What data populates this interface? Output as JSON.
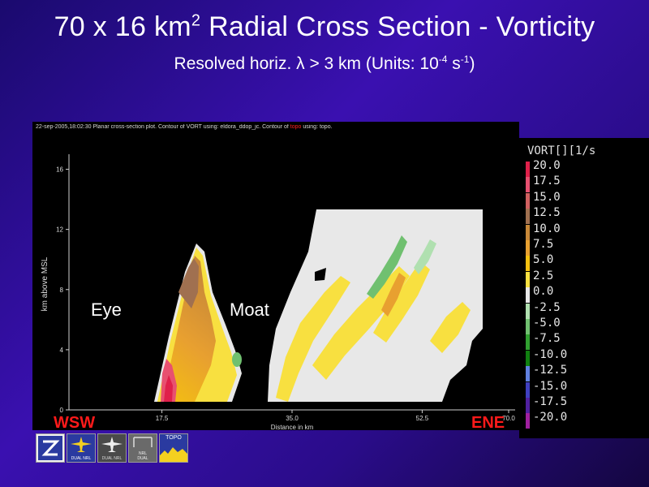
{
  "slide": {
    "title_main": "70 x 16 km",
    "title_sup": "2",
    "title_rest": " Radial Cross Section - Vorticity",
    "subtitle_pre": "Resolved horiz. λ > 3 km (Units: 10",
    "subtitle_sup1": "-4",
    "subtitle_mid": " s",
    "subtitle_sup2": "-1",
    "subtitle_post": ")"
  },
  "plot_header": {
    "text_a": "22-sep-2005,18:02:30  Planar cross-section plot.  Contour of VORT using: eldora_ddop_jc.  Contour of ",
    "text_topo": "topo",
    "text_b": " using: topo."
  },
  "chart_data": {
    "type": "heatmap",
    "xlabel": "Distance in km",
    "ylabel": "km above MSL",
    "xlim": [
      5,
      65
    ],
    "ylim": [
      0,
      17
    ],
    "x_ticks": [
      "17.5",
      "35.0",
      "52.5",
      "70.0"
    ],
    "y_ticks": [
      "0",
      "4",
      "8",
      "12",
      "16"
    ],
    "annotations": {
      "eye": "Eye",
      "moat": "Moat"
    },
    "legend": {
      "title": "VORT[][1/s",
      "levels": [
        {
          "label": "20.0",
          "color": "#e0204a"
        },
        {
          "label": "17.5",
          "color": "#e85070"
        },
        {
          "label": "15.0",
          "color": "#d06060"
        },
        {
          "label": "12.5",
          "color": "#a07050"
        },
        {
          "label": "10.0",
          "color": "#c88838"
        },
        {
          "label": "7.5",
          "color": "#e8a030"
        },
        {
          "label": "5.0",
          "color": "#f4c010"
        },
        {
          "label": "2.5",
          "color": "#f8e040"
        },
        {
          "label": "0.0",
          "color": "#e8e8e8"
        },
        {
          "label": "-2.5",
          "color": "#b0e0b0"
        },
        {
          "label": "-5.0",
          "color": "#70c070"
        },
        {
          "label": "-7.5",
          "color": "#30a030"
        },
        {
          "label": "-10.0",
          "color": "#108010"
        },
        {
          "label": "-12.5",
          "color": "#6080e0"
        },
        {
          "label": "-15.0",
          "color": "#4040c0"
        },
        {
          "label": "-17.5",
          "color": "#5020a0"
        },
        {
          "label": "-20.0",
          "color": "#a020a0"
        }
      ]
    }
  },
  "directions": {
    "west": "WSW",
    "east": "ENE"
  },
  "toolbar": {
    "dual_label_1": "DUAL",
    "nrl_label_1": "NRL",
    "dual_label_2": "DUAL",
    "nrl_label_2": "NRL",
    "nrl_label_3": "NRL",
    "dual_label_3": "DUAL",
    "topo_label": "TOPO"
  }
}
